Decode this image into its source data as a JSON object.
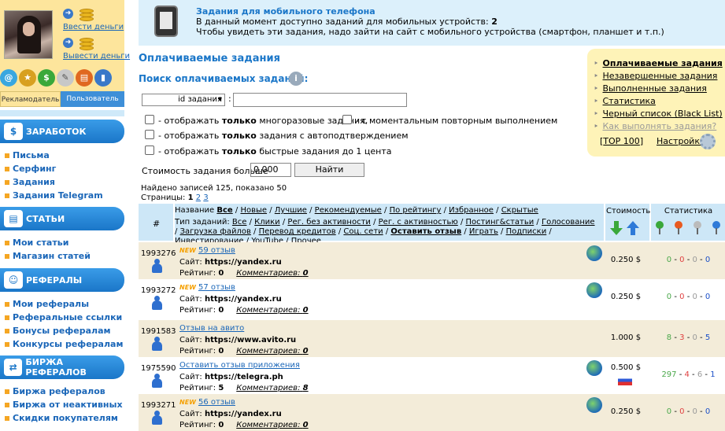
{
  "user": {
    "deposit_label": "Ввести деньги",
    "withdraw_label": "Вывести деньги",
    "tab_advertiser": "Рекламодатель",
    "tab_user": "Пользователь"
  },
  "sidebar": {
    "sections": [
      {
        "title": "ЗАРАБОТОК",
        "items": [
          "Письма",
          "Серфинг",
          "Задания",
          "Задания Telegram"
        ]
      },
      {
        "title": "СТАТЬИ",
        "items": [
          "Мои статьи",
          "Магазин статей"
        ]
      },
      {
        "title": "РЕФЕРАЛЫ",
        "items": [
          "Мои рефералы",
          "Реферальные ссылки",
          "Бонусы рефералам",
          "Конкурсы рефералам"
        ]
      },
      {
        "title": "БИРЖА РЕФЕРАЛОВ",
        "items": [
          "Биржа рефералов",
          "Биржа от неактивных",
          "Скидки покупателям"
        ]
      }
    ]
  },
  "notice": {
    "title": "Задания для мобильного телефона",
    "line2_prefix": "В данный момент доступно заданий для мобильных устройств:",
    "line2_count": "2",
    "line3": "Чтобы увидеть эти задания, надо зайти на сайт с мобильного устройства (смартфон, планшет и т.п.)"
  },
  "page_title": "Оплачиваемые задания",
  "search": {
    "title": "Поиск оплачиваемых заданий:",
    "select_value": "id задания",
    "colon": ":",
    "input_value": "",
    "options": [
      {
        "pre": "- отображать ",
        "bold": "только",
        "post": " многоразовые задания,"
      },
      {
        "pre": "- с моментальным повторным выполнением",
        "bold": "",
        "post": ""
      },
      {
        "pre": "- отображать ",
        "bold": "только",
        "post": " задания с автоподтверждением"
      },
      {
        "pre": "- отображать ",
        "bold": "только",
        "post": " быстрые задания до 1 цента"
      }
    ],
    "cost_label": "Стоимость задания больше",
    "cost_value": "0.000",
    "find_button": "Найти"
  },
  "results": {
    "found_text": "Найдено записей 125, показано 50",
    "pages_label": "Страницы:",
    "pages": [
      "1",
      "2",
      "3"
    ]
  },
  "right_menu": {
    "items": [
      "Оплачиваемые задания",
      "Незавершенные задания",
      "Выполненные задания",
      "Статистика",
      "Черный список (Black List)",
      "Как выполнять задания?"
    ],
    "top100": "TOP 100",
    "settings": "Настройки"
  },
  "table": {
    "col_num": "#",
    "col_price": "Стоимость",
    "col_stats": "Статистика",
    "name_label": "Название",
    "name_filters": [
      "Все",
      "Новые",
      "Лучшие",
      "Рекомендуемые",
      "По рейтингу",
      "Избранное",
      "Скрытые"
    ],
    "type_label": "Тип заданий:",
    "type_filters": [
      "Все",
      "Клики",
      "Рег. без активности",
      "Рег. с активностью",
      "Постинг&статьи",
      "Голосование",
      "Загрузка файлов",
      "Перевод кредитов",
      "Соц. сети",
      "Оставить отзыв",
      "Играть",
      "Подписки",
      "Инвестирование",
      "YouTube",
      "Прочее"
    ],
    "site_label": "Сайт:",
    "rating_label": "Рейтинг:",
    "comments_label": "Комментариев:",
    "rows": [
      {
        "id": "1993276",
        "new": true,
        "title": "59 отзыв",
        "site": "https://yandex.ru",
        "rating": "0",
        "comments": "0",
        "price": "0.250 $",
        "s1": "0",
        "s2": "0",
        "s3": "0",
        "s4": "0",
        "globe": true,
        "flag": false
      },
      {
        "id": "1993272",
        "new": true,
        "title": "57 отзыв",
        "site": "https://yandex.ru",
        "rating": "0",
        "comments": "0",
        "price": "0.250 $",
        "s1": "0",
        "s2": "0",
        "s3": "0",
        "s4": "0",
        "globe": true,
        "flag": false
      },
      {
        "id": "1991583",
        "new": false,
        "title": "Отзыв на авито",
        "site": "https://www.avito.ru",
        "rating": "0",
        "comments": "0",
        "price": "1.000 $",
        "s1": "8",
        "s2": "3",
        "s3": "0",
        "s4": "5",
        "globe": false,
        "flag": false
      },
      {
        "id": "1975590",
        "new": false,
        "title": "Оставить отзыв приложения",
        "site": "https://telegra.ph",
        "rating": "5",
        "comments": "8",
        "price": "0.500 $",
        "s1": "297",
        "s2": "4",
        "s3": "6",
        "s4": "1",
        "globe": true,
        "flag": true
      },
      {
        "id": "1993271",
        "new": true,
        "title": "56 отзыв",
        "site": "https://yandex.ru",
        "rating": "0",
        "comments": "0",
        "price": "0.250 $",
        "s1": "0",
        "s2": "0",
        "s3": "0",
        "s4": "0",
        "globe": true,
        "flag": false
      }
    ]
  },
  "colors": {
    "accent": "#1a76c8",
    "row_alt": "#f3ecd9",
    "header_bg": "#cde7f7",
    "notice_bg": "#dcf0fb"
  }
}
